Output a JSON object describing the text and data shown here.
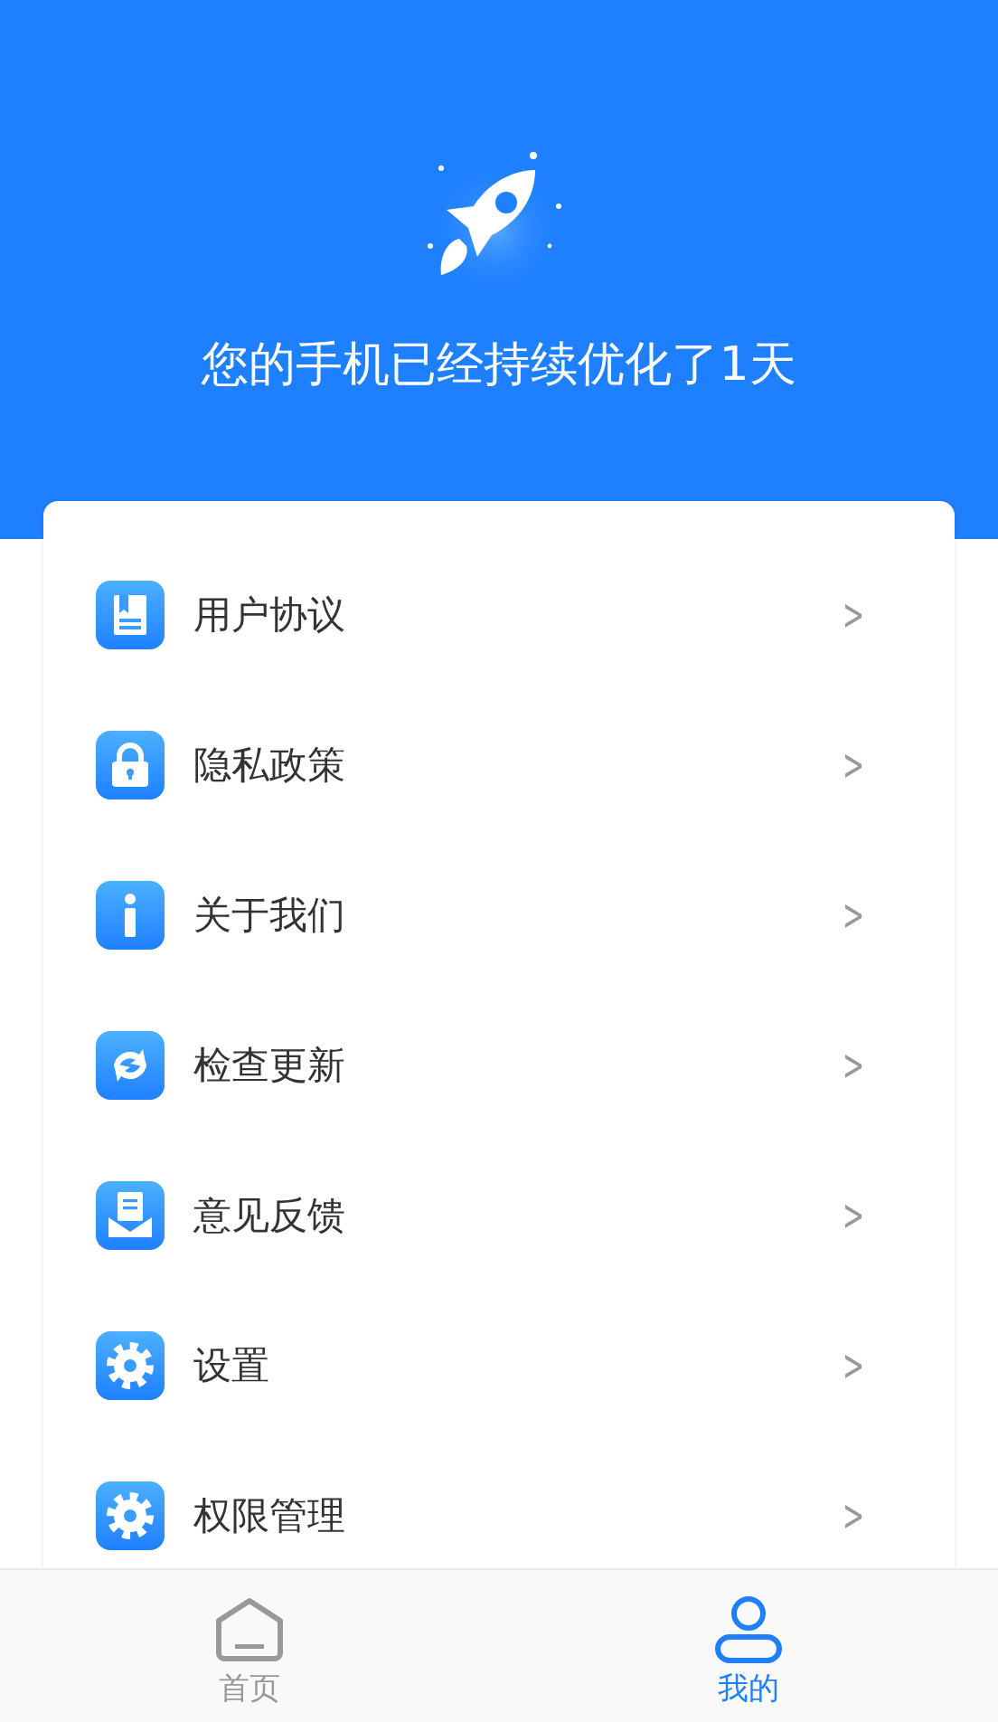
{
  "header": {
    "title": "您的手机已经持续优化了1天"
  },
  "menu": [
    {
      "label": "用户协议",
      "chevron": ">"
    },
    {
      "label": "隐私政策",
      "chevron": ">"
    },
    {
      "label": "关于我们",
      "chevron": ">"
    },
    {
      "label": "检查更新",
      "chevron": ">"
    },
    {
      "label": "意见反馈",
      "chevron": ">"
    },
    {
      "label": "设置",
      "chevron": ">"
    },
    {
      "label": "权限管理",
      "chevron": ">"
    }
  ],
  "tabs": [
    {
      "label": "首页",
      "selected": false
    },
    {
      "label": "我的",
      "selected": true
    }
  ]
}
